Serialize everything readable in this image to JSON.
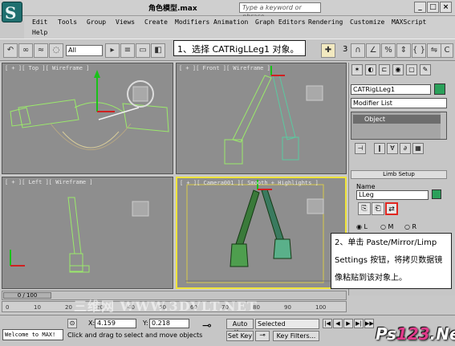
{
  "window": {
    "title": "角色模型.max",
    "search_placeholder": "Type a keyword or phrase",
    "buttons": {
      "minimize": "_",
      "maximize": "□",
      "close": "×"
    }
  },
  "menu": [
    "Edit",
    "Tools",
    "Group",
    "Views",
    "Create",
    "Modifiers",
    "Animation",
    "Graph Editors",
    "Rendering",
    "Customize",
    "MAXScript",
    "Help"
  ],
  "toolbar": {
    "selection_filter": "All",
    "tool_number": "3"
  },
  "callouts": {
    "step1": "1、选择 CATRigLLeg1 对象。",
    "step2": "2、单击 Paste/Mirror/Limp Settings 按钮，将拷贝数据镜像粘贴到该对象上。"
  },
  "viewports": {
    "top": "[ + ][ Top ][ Wireframe ]",
    "front": "[ + ][ Front ][ Wireframe ]",
    "left": "[ + ][ Left ][ Wireframe ]",
    "camera": "[ + ][ Camera001 ][ Smooth + Highlights ]"
  },
  "command_panel": {
    "object_name": "CATRigLLeg1",
    "object_color": "#2aa05a",
    "modifier_list": "Modifier List",
    "stack_item": "Object",
    "rollout_title": "Limb Setup",
    "name_label": "Name",
    "name_value": "LLeg",
    "radio_l": "L",
    "radio_m": "M",
    "radio_r": "R"
  },
  "timeline": {
    "frame_display": "0 / 100",
    "ticks": [
      "0",
      "10",
      "20",
      "30",
      "40",
      "50",
      "60",
      "70",
      "80",
      "90",
      "100"
    ]
  },
  "status": {
    "maxscript": "Welcome to MAX!",
    "prompt": "Click and drag to select and move objects",
    "x_label": "X:",
    "x_value": "4.159",
    "y_label": "Y:",
    "y_value": "0.218",
    "auto_key": "Auto Key",
    "set_key": "Set Key",
    "selected": "Selected",
    "key_filters": "Key Filters..."
  },
  "watermark": "三维网 WWW.3DVLT.NET",
  "site_logo": {
    "part1": "Ps",
    "part2": "123",
    "part3": ".Net"
  }
}
